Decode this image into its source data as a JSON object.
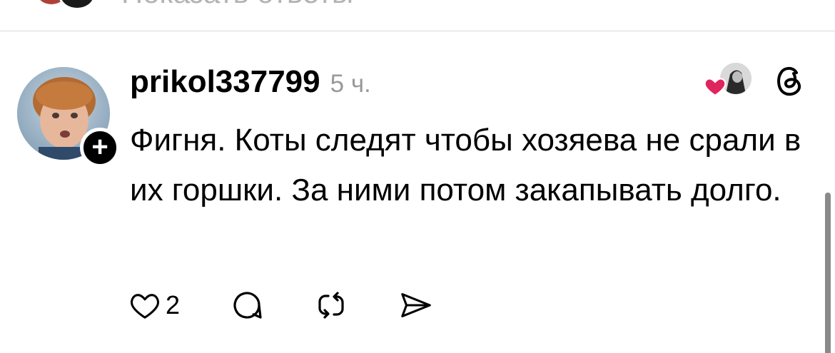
{
  "top_row": {
    "link_text": "Показать ответы"
  },
  "comment": {
    "username": "prikol337799",
    "time": "5 ч.",
    "text": "Фигня. Коты следят чтобы хозяева не срали в их горшки. За ними потом закапывать долго.",
    "follow_symbol": "+",
    "like_count": "2"
  },
  "icons": {
    "avatar": "avatar-photo",
    "follow": "plus-icon",
    "liked_by": "heart-icon",
    "threads": "threads-logo-icon",
    "like": "heart-outline-icon",
    "reply": "comment-icon",
    "repost": "repost-icon",
    "share": "send-icon"
  },
  "colors": {
    "text": "#000000",
    "muted": "#999999",
    "heart": "#e0245e",
    "divider": "#dbdbdb"
  }
}
